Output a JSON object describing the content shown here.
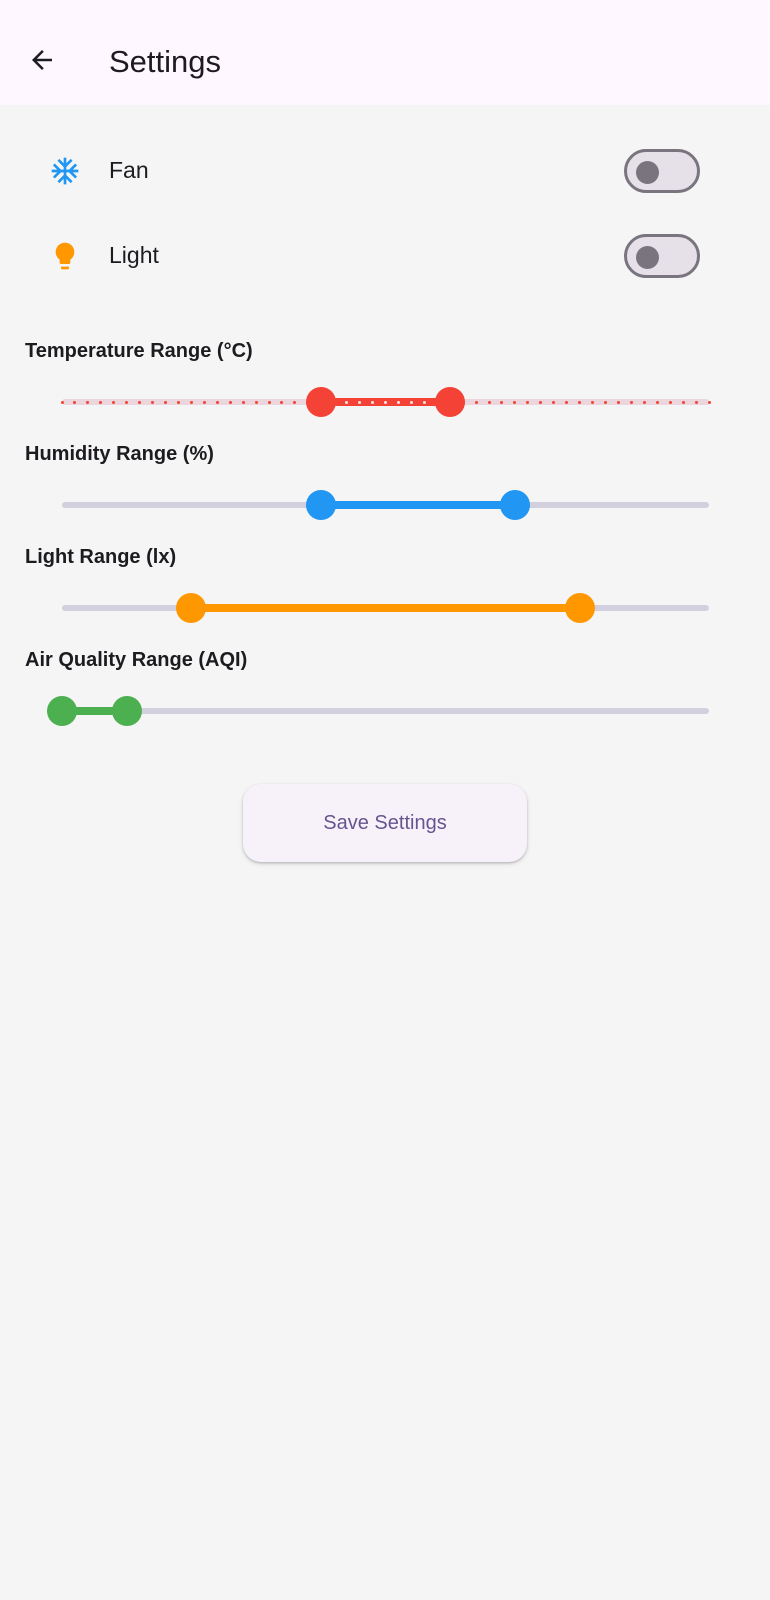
{
  "app_bar": {
    "back_icon": "arrow-back-icon",
    "title": "Settings"
  },
  "switches": [
    {
      "label": "Fan",
      "icon": "snowflake-icon",
      "icon_color": "#2196f3",
      "on": false
    },
    {
      "label": "Light",
      "icon": "lightbulb-icon",
      "icon_color": "#ff9800",
      "on": false
    }
  ],
  "ranges": [
    {
      "label": "Temperature Range (°C)",
      "color": "#f44336",
      "start": 0.4,
      "end": 0.6,
      "divisions": 50
    },
    {
      "label": "Humidity Range (%)",
      "color": "#2196f3",
      "start": 0.4,
      "end": 0.7
    },
    {
      "label": "Light Range (lx)",
      "color": "#ff9800",
      "start": 0.2,
      "end": 0.8
    },
    {
      "label": "Air Quality Range (AQI)",
      "color": "#4caf50",
      "start": 0.0,
      "end": 0.1
    }
  ],
  "save_button": {
    "label": "Save Settings"
  },
  "colors": {
    "app_bar_bg": "#fef7ff",
    "page_bg": "#f4f5f4",
    "inactive_track": "#d2d0de",
    "switch_outline": "#79747e",
    "button_text": "#65558f"
  }
}
